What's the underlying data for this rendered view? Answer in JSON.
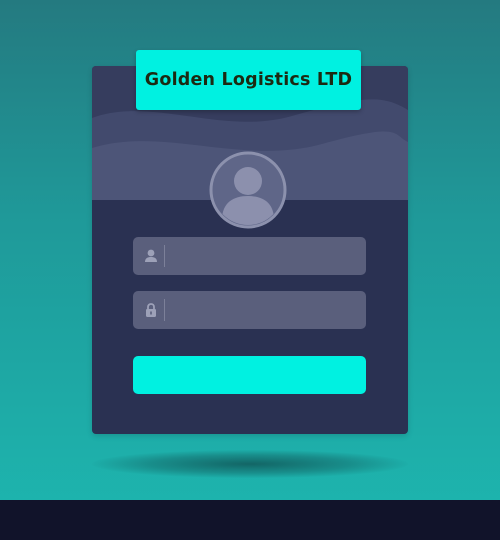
{
  "app": {
    "title": "Golden Logistics LTD"
  },
  "login_form": {
    "username": {
      "icon": "user-icon",
      "value": "",
      "placeholder": ""
    },
    "password": {
      "icon": "lock-icon",
      "value": "",
      "placeholder": ""
    },
    "submit_label": ""
  },
  "colors": {
    "accent": "#00f1e1",
    "card": "#2a3152",
    "field": "#5a5f7c",
    "background_top": "#247a80",
    "background_bottom": "#1db7b0",
    "bottom_bar": "#11132a"
  }
}
